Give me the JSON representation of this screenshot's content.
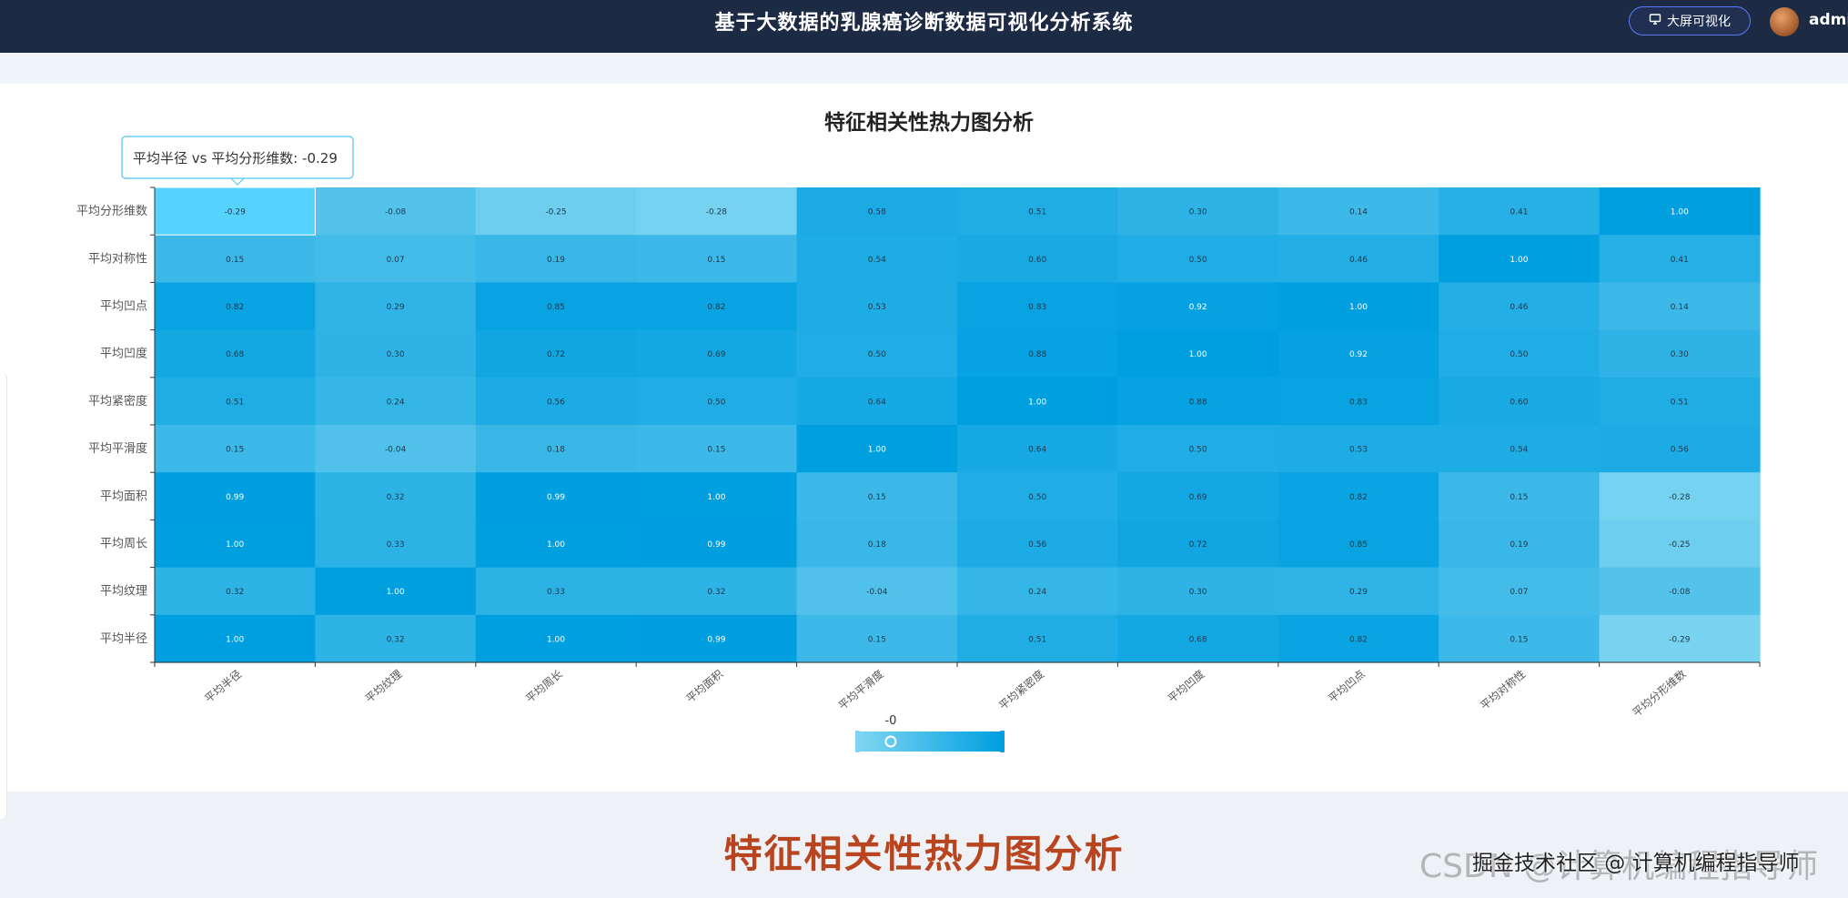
{
  "header": {
    "title": "基于大数据的乳腺癌诊断数据可视化分析系统",
    "big_screen_label": "大屏可视化",
    "username": "admin"
  },
  "colors": {
    "header_bg": "#1d2a44",
    "heat_low": "#7fd6f2",
    "heat_high": "#009fe0",
    "caption": "#b8451f"
  },
  "chart_data": {
    "type": "heatmap",
    "title": "特征相关性热力图分析",
    "x_labels": [
      "平均半径",
      "平均纹理",
      "平均周长",
      "平均面积",
      "平均平滑度",
      "平均紧密度",
      "平均凹度",
      "平均凹点",
      "平均对称性",
      "平均分形维数"
    ],
    "y_labels_top_to_bottom": [
      "平均分形维数",
      "平均对称性",
      "平均凹点",
      "平均凹度",
      "平均紧密度",
      "平均平滑度",
      "平均面积",
      "平均周长",
      "平均纹理",
      "平均半径"
    ],
    "values": [
      [
        "-0.29",
        "-0.08",
        "-0.25",
        "-0.28",
        "0.58",
        "0.51",
        "0.30",
        "0.14",
        "0.41",
        "1.00"
      ],
      [
        "0.15",
        "0.07",
        "0.19",
        "0.15",
        "0.54",
        "0.60",
        "0.50",
        "0.46",
        "1.00",
        "0.41"
      ],
      [
        "0.82",
        "0.29",
        "0.85",
        "0.82",
        "0.53",
        "0.83",
        "0.92",
        "1.00",
        "0.46",
        "0.14"
      ],
      [
        "0.68",
        "0.30",
        "0.72",
        "0.69",
        "0.50",
        "0.88",
        "1.00",
        "0.92",
        "0.50",
        "0.30"
      ],
      [
        "0.51",
        "0.24",
        "0.56",
        "0.50",
        "0.64",
        "1.00",
        "0.88",
        "0.83",
        "0.60",
        "0.51"
      ],
      [
        "0.15",
        "-0.04",
        "0.18",
        "0.15",
        "1.00",
        "0.64",
        "0.50",
        "0.53",
        "0.54",
        "0.56"
      ],
      [
        "0.99",
        "0.32",
        "0.99",
        "1.00",
        "0.15",
        "0.50",
        "0.69",
        "0.82",
        "0.15",
        "-0.28"
      ],
      [
        "1.00",
        "0.33",
        "1.00",
        "0.99",
        "0.18",
        "0.56",
        "0.72",
        "0.85",
        "0.19",
        "-0.25"
      ],
      [
        "0.32",
        "1.00",
        "0.33",
        "0.32",
        "-0.04",
        "0.24",
        "0.30",
        "0.29",
        "0.07",
        "-0.08"
      ],
      [
        "1.00",
        "0.32",
        "1.00",
        "0.99",
        "0.15",
        "0.51",
        "0.68",
        "0.82",
        "0.15",
        "-0.29"
      ]
    ],
    "tooltip": "平均半径 vs 平均分形维数: -0.29",
    "visual_map": {
      "min": -0.3,
      "max": 1.0,
      "handle_label": "-0",
      "handle_value": 0
    }
  },
  "caption": "特征相关性热力图分析",
  "watermark": "CSDN @计算机编程指导师",
  "watermark_overlay": "掘金技术社区 @ 计算机编程指导师"
}
